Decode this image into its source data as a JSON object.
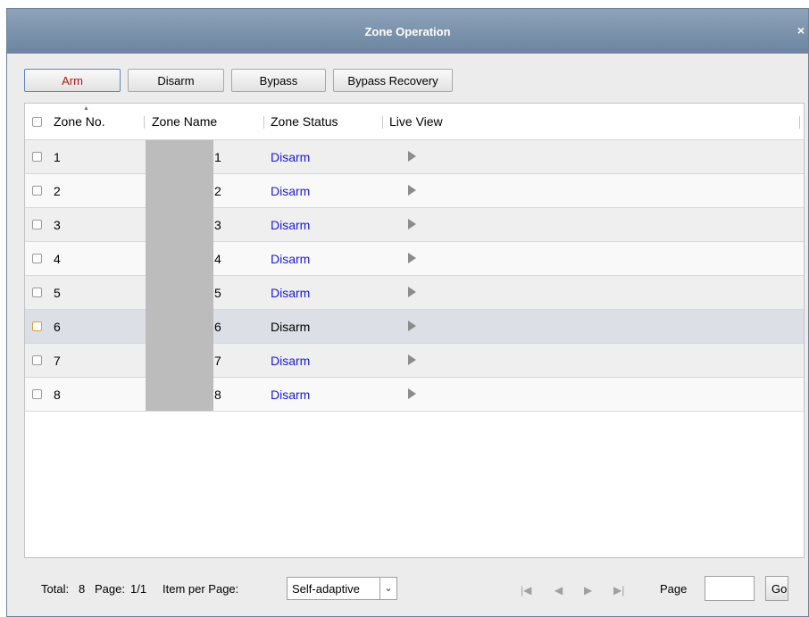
{
  "dialog": {
    "title": "Zone Operation",
    "close_glyph": "×"
  },
  "toolbar": {
    "arm": "Arm",
    "disarm": "Disarm",
    "bypass": "Bypass",
    "bypass_recovery": "Bypass Recovery"
  },
  "columns": {
    "zone_no": "Zone No.",
    "zone_name": "Zone Name",
    "zone_status": "Zone Status",
    "live_view": "Live View"
  },
  "rows": [
    {
      "no": "1",
      "name": "1",
      "status": "Disarm"
    },
    {
      "no": "2",
      "name": "2",
      "status": "Disarm"
    },
    {
      "no": "3",
      "name": "3",
      "status": "Disarm"
    },
    {
      "no": "4",
      "name": "4",
      "status": "Disarm"
    },
    {
      "no": "5",
      "name": "5",
      "status": "Disarm"
    },
    {
      "no": "6",
      "name": "6",
      "status": "Disarm"
    },
    {
      "no": "7",
      "name": "7",
      "status": "Disarm"
    },
    {
      "no": "8",
      "name": "8",
      "status": "Disarm"
    }
  ],
  "selected_row": "6",
  "footer": {
    "total_label": "Total:",
    "total": "8",
    "page_label": "Page:",
    "page": "1/1",
    "items_label": "Item per Page:",
    "items_value": "Self-adaptive",
    "goto_label": "Page",
    "go": "Go"
  },
  "colors": {
    "titlebar": "#7a90aa",
    "status_link": "#1a1ad8",
    "arm_text": "#b01717"
  }
}
